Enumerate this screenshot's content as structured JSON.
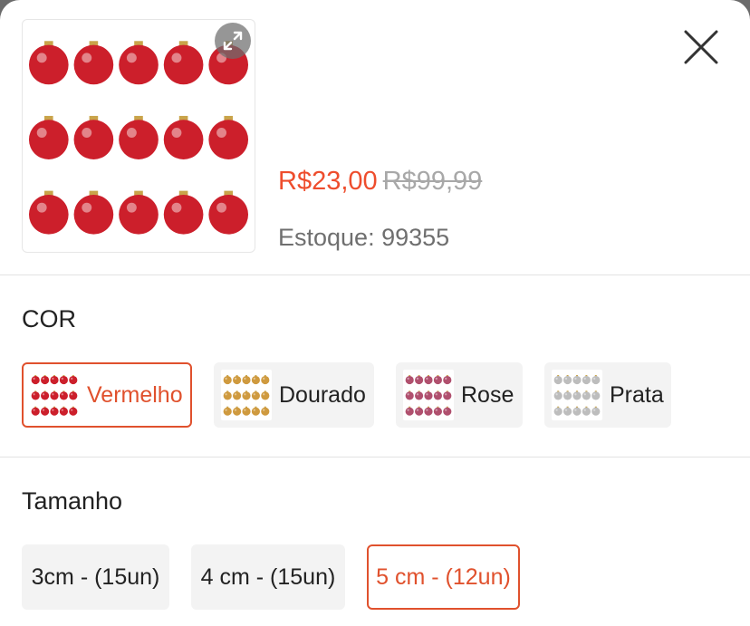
{
  "product": {
    "price": "R$23,00",
    "old_price": "R$99,99",
    "stock_label": "Estoque:",
    "stock_value": "99355"
  },
  "icons": {
    "expand": "expand-icon",
    "close": "close-icon"
  },
  "color_section": {
    "title": "COR",
    "options": [
      {
        "label": "Vermelho",
        "selected": true,
        "swatch_color": "#cc1f2b"
      },
      {
        "label": "Dourado",
        "selected": false,
        "swatch_color": "#cf9a3f"
      },
      {
        "label": "Rose",
        "selected": false,
        "swatch_color": "#b0506e"
      },
      {
        "label": "Prata",
        "selected": false,
        "swatch_color": "#bdbdbd"
      }
    ]
  },
  "size_section": {
    "title": "Tamanho",
    "options": [
      {
        "label": "3cm - (15un)",
        "selected": false
      },
      {
        "label": "4 cm - (15un)",
        "selected": false
      },
      {
        "label": "5 cm - (12un)",
        "selected": true
      }
    ]
  },
  "colors": {
    "accent": "#ee4d2d",
    "option_bg": "#f3f3f3"
  }
}
